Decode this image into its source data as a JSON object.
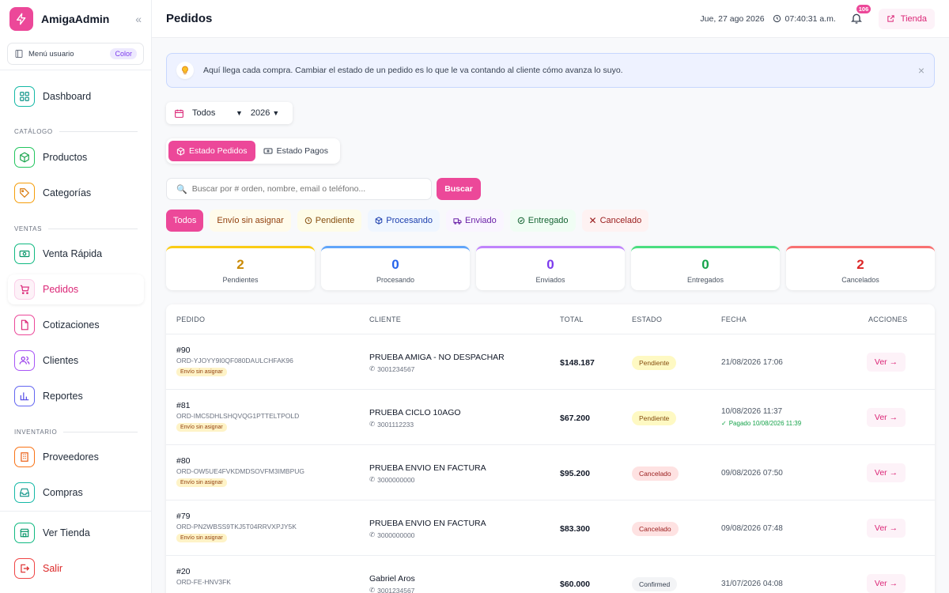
{
  "brand": {
    "name": "AmigaAdmin"
  },
  "user_menu": {
    "label": "Menú usuario",
    "badge": "Color"
  },
  "nav": {
    "dashboard": "Dashboard",
    "section_catalog": "CATÁLOGO",
    "products": "Productos",
    "categories": "Categorías",
    "section_sales": "VENTAS",
    "quick_sale": "Venta Rápida",
    "orders": "Pedidos",
    "quotes": "Cotizaciones",
    "clients": "Clientes",
    "reports": "Reportes",
    "section_inventory": "INVENTARIO",
    "suppliers": "Proveedores",
    "purchases": "Compras",
    "view_store": "Ver Tienda",
    "logout": "Salir"
  },
  "header": {
    "title": "Pedidos",
    "date": "Jue, 27 ago 2026",
    "time": "07:40:31 a.m.",
    "notif_count": "106",
    "store_button": "Tienda"
  },
  "banner": {
    "text": "Aquí llega cada compra. Cambiar el estado de un pedido es lo que le va contando al cliente cómo avanza lo suyo."
  },
  "filters": {
    "period": "Todos",
    "year": "2026"
  },
  "view_toggle": {
    "orders_status": "Estado Pedidos",
    "payments_status": "Estado Pagos"
  },
  "search": {
    "placeholder": "Buscar por # orden, nombre, email o teléfono...",
    "button": "Buscar"
  },
  "status_chips": [
    "Todos",
    "Envío sin asignar",
    "Pendiente",
    "Procesando",
    "Enviado",
    "Entregado",
    "Cancelado"
  ],
  "stats": [
    {
      "value": "2",
      "label": "Pendientes"
    },
    {
      "value": "0",
      "label": "Procesando"
    },
    {
      "value": "0",
      "label": "Enviados"
    },
    {
      "value": "0",
      "label": "Entregados"
    },
    {
      "value": "2",
      "label": "Cancelados"
    }
  ],
  "table": {
    "headers": {
      "order": "PEDIDO",
      "client": "CLIENTE",
      "total": "TOTAL",
      "status": "ESTADO",
      "date": "FECHA",
      "actions": "ACCIONES"
    },
    "action_label": "Ver →",
    "rows": [
      {
        "id": "#90",
        "code": "ORD-YJOYY9I0QF080DAULCHFAK96",
        "tag": "Envío sin asignar",
        "client": "PRUEBA AMIGA - NO DESPACHAR",
        "phone": "3001234567",
        "total": "$148.187",
        "status": "Pendiente",
        "date": "21/08/2026 17:06",
        "paid": ""
      },
      {
        "id": "#81",
        "code": "ORD-IMC5DHLSHQVQG1PTTELTPOLD",
        "tag": "Envío sin asignar",
        "client": "PRUEBA CICLO 10AGO",
        "phone": "3001112233",
        "total": "$67.200",
        "status": "Pendiente",
        "date": "10/08/2026 11:37",
        "paid": "Pagado 10/08/2026 11:39"
      },
      {
        "id": "#80",
        "code": "ORD-OW5UE4FVKDMDSOVFM3IMBPUG",
        "tag": "Envío sin asignar",
        "client": "PRUEBA ENVIO EN FACTURA",
        "phone": "3000000000",
        "total": "$95.200",
        "status": "Cancelado",
        "date": "09/08/2026 07:50",
        "paid": ""
      },
      {
        "id": "#79",
        "code": "ORD-PN2WBSS9TKJ5T04RRVXPJY5K",
        "tag": "Envío sin asignar",
        "client": "PRUEBA ENVIO EN FACTURA",
        "phone": "3000000000",
        "total": "$83.300",
        "status": "Cancelado",
        "date": "09/08/2026 07:48",
        "paid": ""
      },
      {
        "id": "#20",
        "code": "ORD-FE-HNV3FK",
        "tag": "",
        "client": "Gabriel Aros",
        "phone": "3001234567",
        "total": "$60.000",
        "status": "Confirmed",
        "date": "31/07/2026 04:08",
        "paid": ""
      }
    ]
  },
  "colors": {
    "accent": "#ec4899",
    "pending": "#ca8a04",
    "processing": "#2563eb",
    "shipped": "#7c3aed",
    "delivered": "#16a34a",
    "cancelled": "#dc2626"
  }
}
